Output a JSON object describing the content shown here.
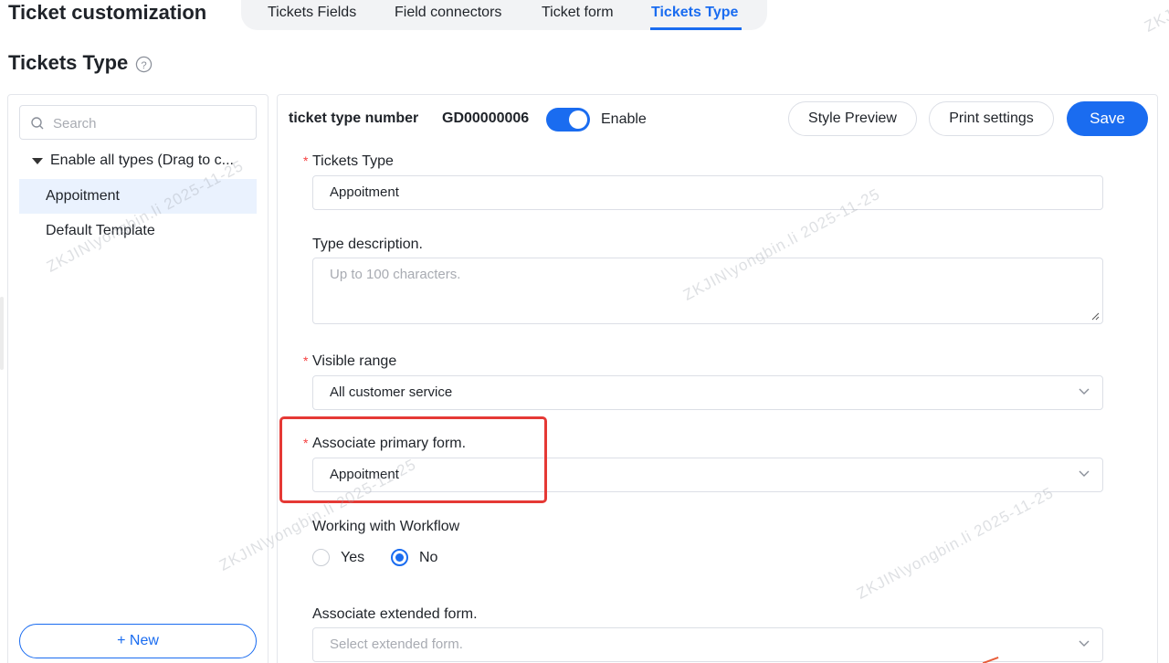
{
  "app": {
    "title": "Ticket customization"
  },
  "tabs": [
    {
      "label": "Tickets Fields"
    },
    {
      "label": "Field connectors"
    },
    {
      "label": "Ticket form"
    },
    {
      "label": "Tickets Type"
    }
  ],
  "page": {
    "title": "Tickets Type"
  },
  "sidebar": {
    "search_placeholder": "Search",
    "group_label": "Enable all types (Drag to c...",
    "items": [
      {
        "label": "Appoitment",
        "selected": true
      },
      {
        "label": "Default Template",
        "selected": false
      }
    ],
    "new_label": "+ New"
  },
  "header": {
    "number_label": "ticket type number",
    "number_value": "GD00000006",
    "enable_label": "Enable",
    "enabled": true,
    "style_preview_label": "Style Preview",
    "print_settings_label": "Print settings",
    "save_label": "Save"
  },
  "form": {
    "tickets_type": {
      "label": "Tickets Type",
      "value": "Appoitment",
      "required": true
    },
    "type_description": {
      "label": "Type description.",
      "placeholder": "Up to 100 characters."
    },
    "visible_range": {
      "label": "Visible range",
      "value": "All customer service",
      "required": true
    },
    "associate_primary": {
      "label": "Associate primary form.",
      "value": "Appoitment",
      "required": true
    },
    "workflow": {
      "label": "Working with Workflow",
      "yes_label": "Yes",
      "no_label": "No",
      "selected": "No"
    },
    "associate_extended": {
      "label": "Associate extended form.",
      "placeholder": "Select extended form."
    }
  },
  "watermark": {
    "text": "ZKJIN\\yongbin.li  2025-11-25"
  },
  "colors": {
    "accent": "#1a6cf0",
    "required": "#f53f3f",
    "highlight": "#e53935"
  }
}
